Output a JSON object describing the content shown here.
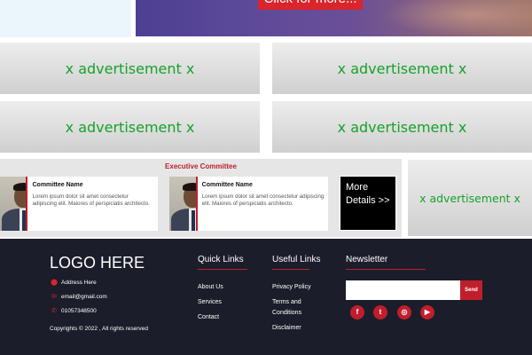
{
  "hero": {
    "cta_label": "Click for more..."
  },
  "ads": {
    "label": "x advertisement x"
  },
  "committee": {
    "title": "Executive Committee",
    "members": [
      {
        "name": "Committee Name",
        "description": "Lorem ipsum dolor sit amet consectetur adipiscing elit. Maiores of perspiciatis architecto."
      },
      {
        "name": "Committee Name",
        "description": "Lorem ipsum dolor sit amet consectetur adipiscing elit. Maiores of perspiciatis architecto."
      }
    ],
    "more_details_label": "More Details >>"
  },
  "footer": {
    "logo": "LOGO HERE",
    "address": "Address Here",
    "email": "email@gmail.com",
    "phone": "01057348500",
    "copyright": "Copyrights © 2022 , All rights reserved",
    "quick_links": {
      "heading": "Quick Links",
      "items": [
        "About Us",
        "Services",
        "Contact"
      ]
    },
    "useful_links": {
      "heading": "Useful Links",
      "items": [
        "Privacy Policy",
        "Terms and Conditions",
        "Disclaimer"
      ]
    },
    "newsletter": {
      "heading": "Newsletter",
      "placeholder": "",
      "send_label": "Send"
    },
    "social": [
      {
        "icon": "facebook-icon",
        "glyph": "f"
      },
      {
        "icon": "twitter-icon",
        "glyph": "t"
      },
      {
        "icon": "instagram-icon",
        "glyph": "◎"
      },
      {
        "icon": "youtube-icon",
        "glyph": "▶"
      }
    ]
  },
  "colors": {
    "accent": "#c01e2c",
    "ad_text": "#17a12a",
    "footer_bg": "#1b1d2a"
  }
}
